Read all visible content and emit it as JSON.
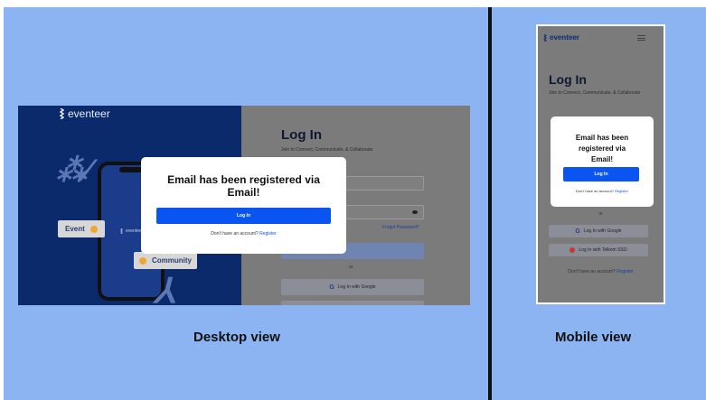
{
  "brand": {
    "name": "eventeer"
  },
  "desktop": {
    "caption": "Desktop view",
    "chips": {
      "event": "Event",
      "community": "Community"
    },
    "login": {
      "title": "Log In",
      "subtitle": "Join to Connect, Communicate, & Collaborate",
      "forgot_password": "Forgot Password?",
      "or": "or",
      "google_button": "Log In with Google"
    },
    "modal": {
      "title": "Email has been registered via Email!",
      "button": "Log In",
      "footer_text": "Don't have an account?",
      "footer_link": "Register"
    }
  },
  "mobile": {
    "caption": "Mobile view",
    "login": {
      "title": "Log In",
      "subtitle": "Join to Connect, Communicate, & Collaborate",
      "or": "or",
      "google_button": "Log In with Google",
      "telkom_button": "Log In with Telkom SSO",
      "footer_text": "Don't have an account?",
      "footer_link": "Register"
    },
    "modal": {
      "title": "Email has been registered via Email!",
      "button": "Log In",
      "footer_text": "Don't have an account?",
      "footer_link": "Register"
    }
  },
  "colors": {
    "background": "#8db4f2",
    "divider": "#111111",
    "primary": "#0a55f2",
    "desktop_left_panel": "#0a2a6b"
  }
}
